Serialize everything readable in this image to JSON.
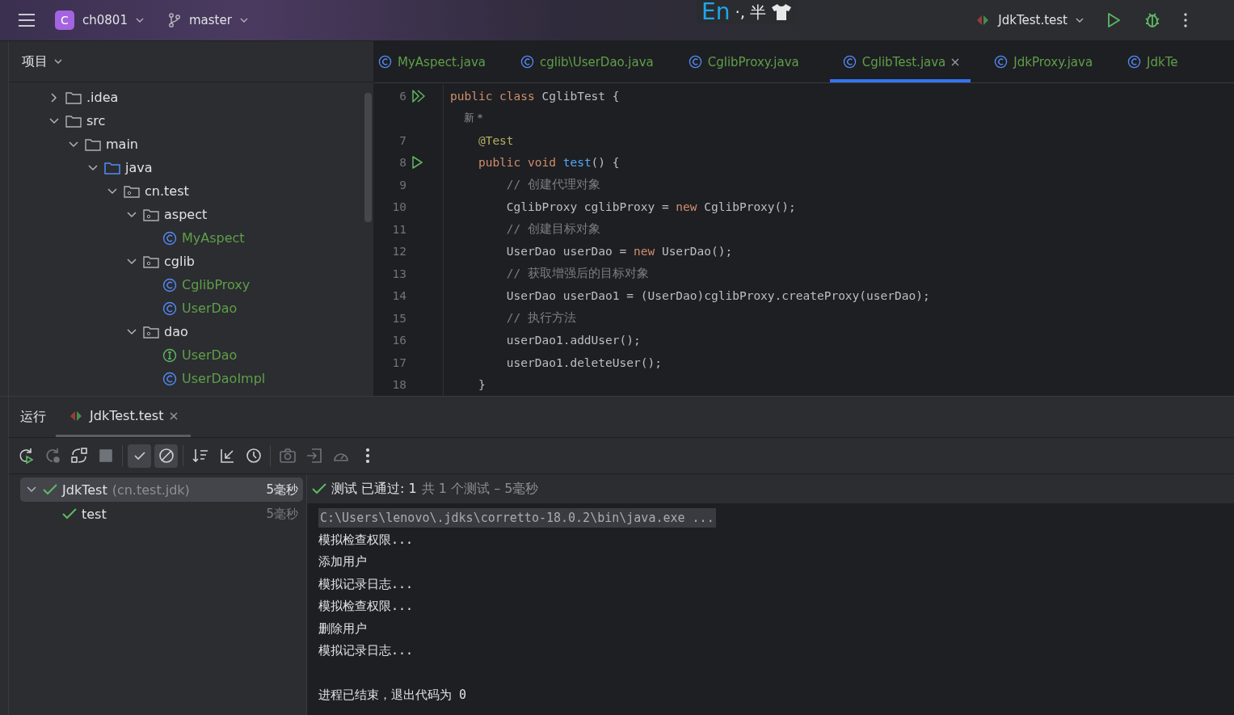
{
  "top_bar": {
    "project_badge": "C",
    "project": "ch0801",
    "branch": "master",
    "run_config": "JdkTest.test"
  },
  "ime_bar": {
    "mode": "En",
    "punctuation": "·,",
    "width": "半"
  },
  "project_panel": {
    "title": "项目",
    "tree": [
      {
        "name": ".idea",
        "kind": "folder",
        "expanded": false
      },
      {
        "name": "src",
        "kind": "folder",
        "expanded": true,
        "children": [
          {
            "name": "main",
            "kind": "folder",
            "expanded": true,
            "children": [
              {
                "name": "java",
                "kind": "source",
                "expanded": true,
                "children": [
                  {
                    "name": "cn.test",
                    "kind": "package",
                    "expanded": true,
                    "children": [
                      {
                        "name": "aspect",
                        "kind": "package",
                        "expanded": true,
                        "children": [
                          {
                            "name": "MyAspect",
                            "kind": "class"
                          }
                        ]
                      },
                      {
                        "name": "cglib",
                        "kind": "package",
                        "expanded": true,
                        "children": [
                          {
                            "name": "CglibProxy",
                            "kind": "class"
                          },
                          {
                            "name": "UserDao",
                            "kind": "class"
                          }
                        ]
                      },
                      {
                        "name": "dao",
                        "kind": "package",
                        "expanded": true,
                        "children": [
                          {
                            "name": "UserDao",
                            "kind": "interface"
                          },
                          {
                            "name": "UserDaoImpl",
                            "kind": "class"
                          }
                        ]
                      }
                    ]
                  }
                ]
              }
            ]
          }
        ]
      }
    ]
  },
  "editor": {
    "tabs": [
      {
        "label": "MyAspect.java",
        "selected": false
      },
      {
        "label": "cglib\\UserDao.java",
        "selected": false
      },
      {
        "label": "CglibProxy.java",
        "selected": false
      },
      {
        "label": "CglibTest.java",
        "selected": true
      },
      {
        "label": "JdkProxy.java",
        "selected": false
      },
      {
        "label": "JdkTe",
        "selected": false
      }
    ],
    "lines": [
      {
        "number": "6",
        "kind": "runnable-class",
        "tokens": [
          {
            "text": "public class ",
            "kind": "keyword"
          },
          {
            "text": "CglibTest {",
            "kind": "plain"
          }
        ]
      },
      {
        "kind": "hint",
        "tokens": [
          {
            "text": "    新 *",
            "kind": "hint"
          }
        ]
      },
      {
        "number": "7",
        "kind": "code",
        "tokens": [
          {
            "text": "    @Test",
            "kind": "annotation"
          }
        ]
      },
      {
        "number": "8",
        "kind": "runnable-method",
        "tokens": [
          {
            "text": "    public void ",
            "kind": "keyword"
          },
          {
            "text": "test",
            "kind": "method"
          },
          {
            "text": "() {",
            "kind": "plain"
          }
        ]
      },
      {
        "number": "9",
        "kind": "code",
        "tokens": [
          {
            "text": "        // 创建代理对象",
            "kind": "comment"
          }
        ]
      },
      {
        "number": "10",
        "kind": "code",
        "tokens": [
          {
            "text": "        CglibProxy cglibProxy = ",
            "kind": "plain"
          },
          {
            "text": "new ",
            "kind": "keyword"
          },
          {
            "text": "CglibProxy();",
            "kind": "plain"
          }
        ]
      },
      {
        "number": "11",
        "kind": "code",
        "tokens": [
          {
            "text": "        // 创建目标对象",
            "kind": "comment"
          }
        ]
      },
      {
        "number": "12",
        "kind": "code",
        "tokens": [
          {
            "text": "        UserDao userDao = ",
            "kind": "plain"
          },
          {
            "text": "new ",
            "kind": "keyword"
          },
          {
            "text": "UserDao();",
            "kind": "plain"
          }
        ]
      },
      {
        "number": "13",
        "kind": "code",
        "tokens": [
          {
            "text": "        // 获取增强后的目标对象",
            "kind": "comment"
          }
        ]
      },
      {
        "number": "14",
        "kind": "code",
        "tokens": [
          {
            "text": "        UserDao userDao1 = (UserDao)cglibProxy.createProxy(userDao);",
            "kind": "plain"
          }
        ]
      },
      {
        "number": "15",
        "kind": "code",
        "tokens": [
          {
            "text": "        // 执行方法",
            "kind": "comment"
          }
        ]
      },
      {
        "number": "16",
        "kind": "code",
        "tokens": [
          {
            "text": "        userDao1.addUser();",
            "kind": "plain"
          }
        ]
      },
      {
        "number": "17",
        "kind": "code",
        "tokens": [
          {
            "text": "        userDao1.deleteUser();",
            "kind": "plain"
          }
        ]
      },
      {
        "number": "18",
        "kind": "code",
        "tokens": [
          {
            "text": "    }",
            "kind": "plain"
          }
        ]
      }
    ]
  },
  "run_panel": {
    "title": "运行",
    "tab": "JdkTest.test",
    "toolbar": [
      {
        "kind": "rerun",
        "on": false,
        "disabled": false
      },
      {
        "kind": "rerun-failed",
        "on": false,
        "disabled": true
      },
      {
        "kind": "auto-test",
        "on": false,
        "disabled": false
      },
      {
        "kind": "stop",
        "on": false,
        "disabled": true
      },
      {
        "kind": "show-passed",
        "on": true,
        "disabled": false
      },
      {
        "kind": "show-ignored",
        "on": true,
        "disabled": false
      },
      {
        "kind": "sort",
        "on": false,
        "disabled": false
      },
      {
        "kind": "collapse",
        "on": false,
        "disabled": false
      },
      {
        "kind": "history",
        "on": false,
        "disabled": false
      },
      {
        "kind": "snapshot",
        "on": false,
        "disabled": true
      },
      {
        "kind": "import",
        "on": false,
        "disabled": true
      },
      {
        "kind": "coverage",
        "on": false,
        "disabled": true
      },
      {
        "kind": "more",
        "on": false,
        "disabled": false
      }
    ],
    "tests": [
      {
        "name": "JdkTest",
        "package": "(cn.test.jdk)",
        "time": "5毫秒",
        "selected": true,
        "expanded": true,
        "passed": true,
        "children": [
          {
            "name": "test",
            "time": "5毫秒",
            "selected": false,
            "passed": true
          }
        ]
      }
    ],
    "status": {
      "result": "测试 已通过: 1",
      "summary": "共 1 个测试 – 5毫秒",
      "passed": true
    },
    "console": [
      {
        "kind": "command",
        "text": "C:\\Users\\lenovo\\.jdks\\corretto-18.0.2\\bin\\java.exe ..."
      },
      {
        "kind": "output",
        "text": "模拟检查权限..."
      },
      {
        "kind": "output",
        "text": "添加用户"
      },
      {
        "kind": "output",
        "text": "模拟记录日志..."
      },
      {
        "kind": "output",
        "text": "模拟检查权限..."
      },
      {
        "kind": "output",
        "text": "删除用户"
      },
      {
        "kind": "output",
        "text": "模拟记录日志..."
      },
      {
        "kind": "exit",
        "text": "进程已结束，退出代码为 0"
      }
    ]
  }
}
